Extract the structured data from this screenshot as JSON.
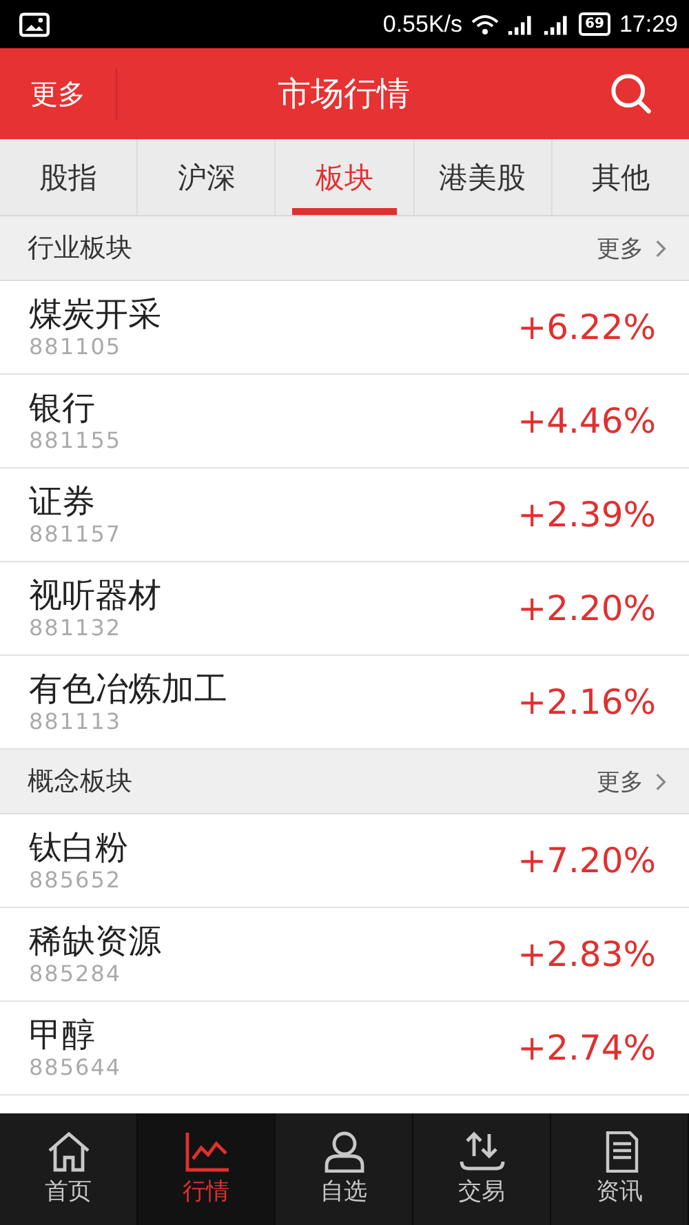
{
  "status_bar": {
    "speed": "0.55K/s",
    "battery": "69",
    "time": "17:29"
  },
  "header": {
    "left": "更多",
    "title": "市场行情"
  },
  "tabs": [
    {
      "label": "股指",
      "selected": false
    },
    {
      "label": "沪深",
      "selected": false
    },
    {
      "label": "板块",
      "selected": true
    },
    {
      "label": "港美股",
      "selected": false
    },
    {
      "label": "其他",
      "selected": false
    }
  ],
  "sections": [
    {
      "title": "行业板块",
      "more": "更多",
      "rows": [
        {
          "name": "煤炭开采",
          "code": "881105",
          "change": "+6.22%"
        },
        {
          "name": "银行",
          "code": "881155",
          "change": "+4.46%"
        },
        {
          "name": "证券",
          "code": "881157",
          "change": "+2.39%"
        },
        {
          "name": "视听器材",
          "code": "881132",
          "change": "+2.20%"
        },
        {
          "name": "有色冶炼加工",
          "code": "881113",
          "change": "+2.16%"
        }
      ]
    },
    {
      "title": "概念板块",
      "more": "更多",
      "rows": [
        {
          "name": "钛白粉",
          "code": "885652",
          "change": "+7.20%"
        },
        {
          "name": "稀缺资源",
          "code": "885284",
          "change": "+2.83%"
        },
        {
          "name": "甲醇",
          "code": "885644",
          "change": "+2.74%"
        }
      ]
    }
  ],
  "bottom_nav": [
    {
      "label": "首页",
      "kind": "home",
      "selected": false
    },
    {
      "label": "行情",
      "kind": "chart",
      "selected": true
    },
    {
      "label": "自选",
      "kind": "person",
      "selected": false
    },
    {
      "label": "交易",
      "kind": "trade",
      "selected": false
    },
    {
      "label": "资讯",
      "kind": "news",
      "selected": false
    }
  ]
}
